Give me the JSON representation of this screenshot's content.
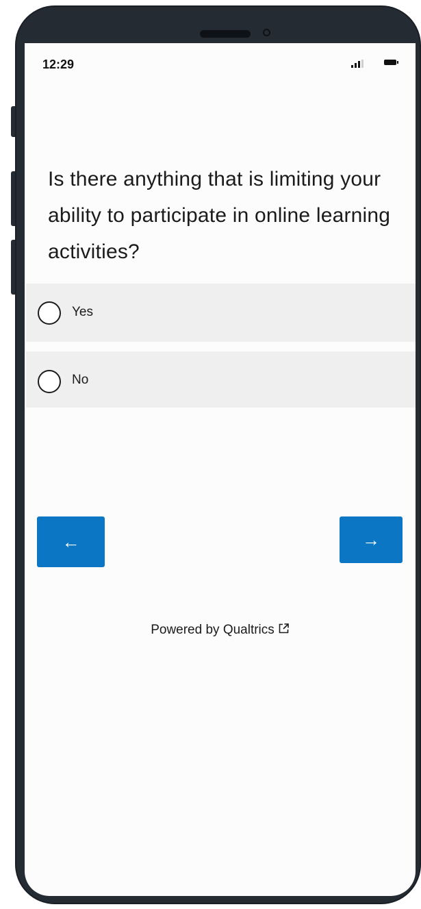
{
  "status_bar": {
    "time": "12:29",
    "signal_icon": "cellular-signal-icon",
    "battery_icon": "battery-icon"
  },
  "survey": {
    "question": "Is there anything that is limiting your ability to participate in online learning activities?",
    "choices": [
      {
        "label": "Yes",
        "selected": false
      },
      {
        "label": "No",
        "selected": false
      }
    ]
  },
  "navigation": {
    "back_label": "←",
    "next_label": "→"
  },
  "footer": {
    "powered_by": "Powered by Qualtrics",
    "external_link_icon": "external-link-icon"
  },
  "colors": {
    "frame": "#242b33",
    "screen_background": "#fcfcfc",
    "choice_background": "#efefef",
    "button_accent": "#0a76c4"
  }
}
